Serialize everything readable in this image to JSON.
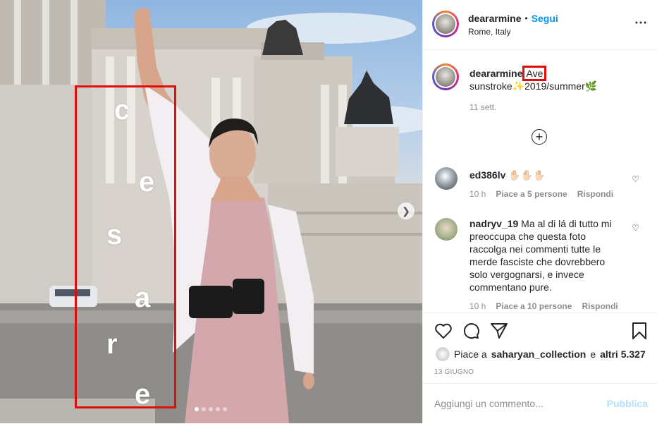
{
  "photo": {
    "overlay_letters": [
      "c",
      "e",
      "s",
      "a",
      "r",
      "e"
    ],
    "carousel_count": 5,
    "carousel_active": 0
  },
  "post_header": {
    "username": "deararmine",
    "separator": "•",
    "follow_label": "Segui",
    "location": "Rome, Italy",
    "more_icon": "⋯"
  },
  "caption": {
    "username": "deararmine",
    "highlight_word": "Ave",
    "line2_prefix": "sunstroke",
    "line2_suffix": "2019/summer",
    "emoji_sparkle": "✨",
    "emoji_leaf": "🌿",
    "time": "11 sett."
  },
  "load_more_icon": "+",
  "comments": [
    {
      "username": "ed386lv",
      "text": "✋🏻✋🏻✋🏻",
      "time": "10 h",
      "likes": "Piace a 5 persone",
      "reply": "Rispondi"
    },
    {
      "username": "nadryv_19",
      "text": "Ma al di lá di tutto mi preoccupa che questa foto raccolga nei commenti tutte le merde fasciste che dovrebbero solo vergognarsi, e invece commentano pure.",
      "time": "10 h",
      "likes": "Piace a 10 persone",
      "reply": "Rispondi"
    }
  ],
  "likes": {
    "prefix": "Piace a",
    "user": "saharyan_collection",
    "middle": "e",
    "others": "altri 5.327"
  },
  "post_date": "13 GIUGNO",
  "add_comment": {
    "placeholder": "Aggiungi un commento...",
    "publish_label": "Pubblica"
  },
  "colors": {
    "highlight_red": "#e10d0d",
    "follow_blue": "#0095f6",
    "publish_disabled": "#b2dffc"
  }
}
